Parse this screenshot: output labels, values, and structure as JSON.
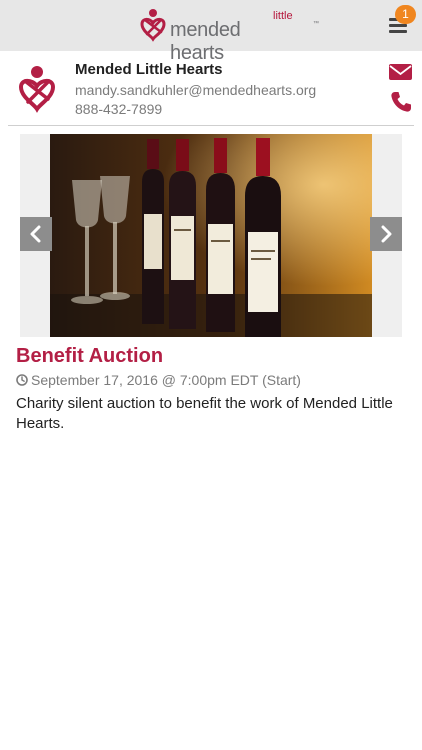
{
  "header": {
    "brand_small": "little",
    "brand_big": "mended hearts",
    "brand_tm": "™",
    "notification_count": "1",
    "menu_icon": "hamburger-icon"
  },
  "organization": {
    "name": "Mended Little Hearts",
    "email": "mandy.sandkuhler@mendedhearts.org",
    "phone": "888-432-7899",
    "mail_icon": "envelope-icon",
    "phone_icon": "phone-icon"
  },
  "carousel": {
    "prev_icon": "chevron-left-icon",
    "next_icon": "chevron-right-icon",
    "image": "wine-bottles-and-glasses-photo"
  },
  "event": {
    "title": "Benefit Auction",
    "date": "September 17, 2016 @ 7:00pm EDT (Start)",
    "description": "Charity silent auction to benefit the work of Mended Little Hearts."
  },
  "colors": {
    "brand_red": "#b31f45",
    "header_bg": "#e7e7e7",
    "badge": "#f0861f",
    "muted_text": "#7b7b7b"
  }
}
